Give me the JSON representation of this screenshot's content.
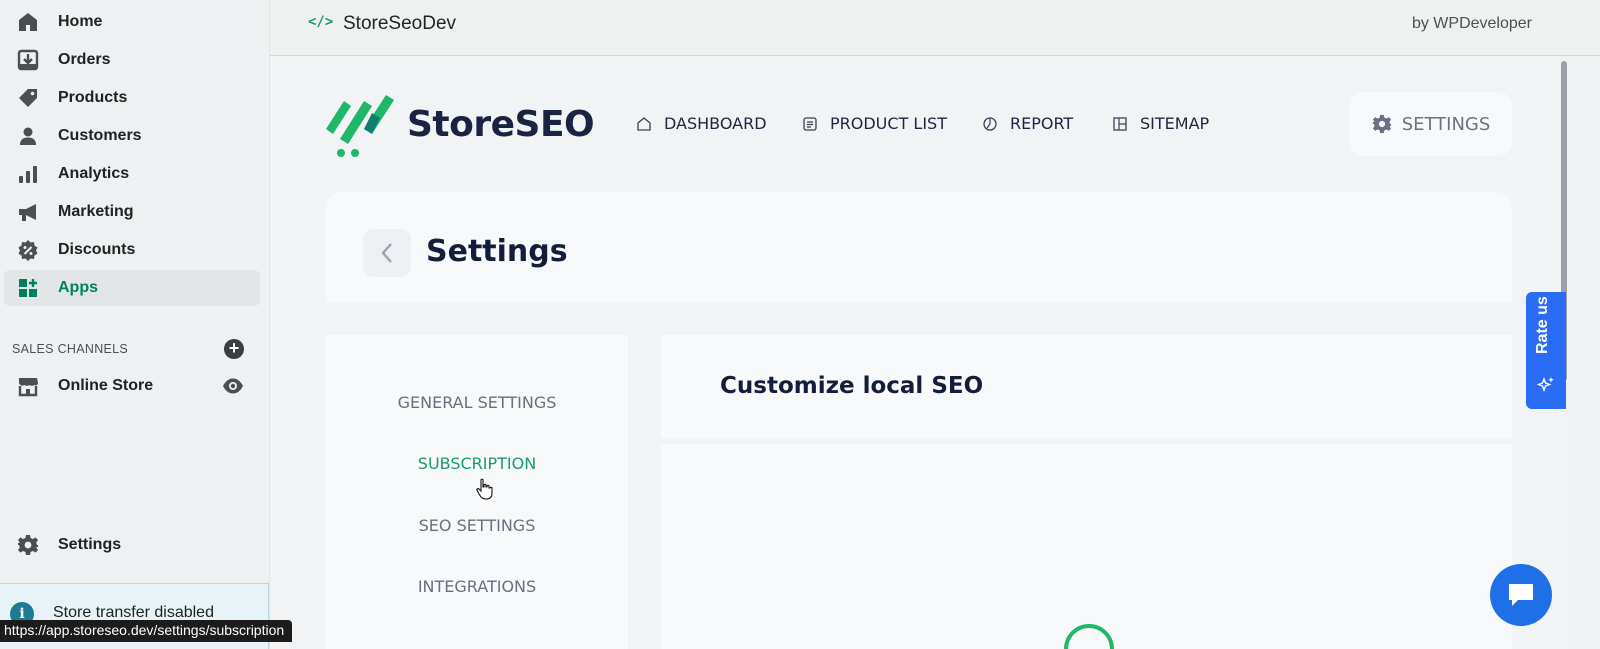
{
  "sidebar": {
    "items": [
      {
        "label": "Home"
      },
      {
        "label": "Orders"
      },
      {
        "label": "Products"
      },
      {
        "label": "Customers"
      },
      {
        "label": "Analytics"
      },
      {
        "label": "Marketing"
      },
      {
        "label": "Discounts"
      },
      {
        "label": "Apps"
      }
    ],
    "sales_channels_label": "SALES CHANNELS",
    "online_store_label": "Online Store",
    "settings_label": "Settings",
    "banner_text": "Store transfer disabled"
  },
  "status_url": "https://app.storeseo.dev/settings/subscription",
  "app_bar": {
    "code_glyph": "</>",
    "app_name": "StoreSeoDev",
    "developer": "by WPDeveloper"
  },
  "app": {
    "brand": "StoreSEO",
    "nav": [
      {
        "label": "DASHBOARD"
      },
      {
        "label": "PRODUCT LIST"
      },
      {
        "label": "REPORT"
      },
      {
        "label": "SITEMAP"
      }
    ],
    "settings_button": "SETTINGS",
    "page_title": "Settings",
    "menu": [
      {
        "label": "GENERAL SETTINGS"
      },
      {
        "label": "SUBSCRIPTION"
      },
      {
        "label": "SEO SETTINGS"
      },
      {
        "label": "INTEGRATIONS"
      }
    ],
    "panel_title": "Customize local SEO",
    "rate_us": "Rate us"
  },
  "colors": {
    "accent": "#1a9b6c",
    "brand_dark": "#1b2342",
    "rate_blue": "#2a6df4"
  }
}
